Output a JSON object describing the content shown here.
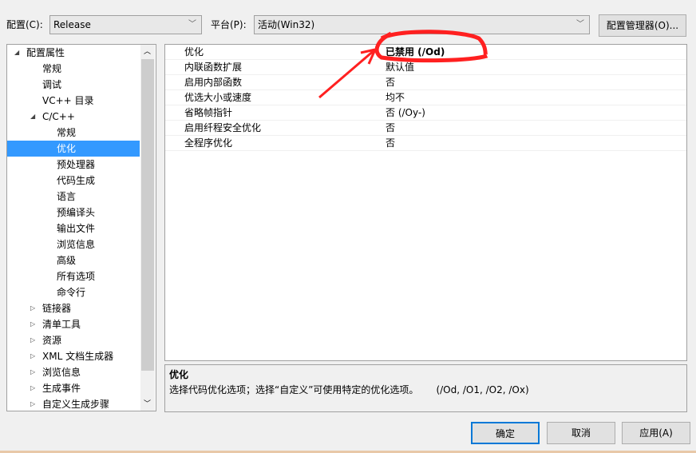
{
  "toolbar": {
    "config_label": "配置(C):",
    "config_value": "Release",
    "platform_label": "平台(P):",
    "platform_value": "活动(Win32)",
    "config_manager": "配置管理器(O)..."
  },
  "tree": [
    {
      "label": "配置属性",
      "level": 0,
      "expander": "◢"
    },
    {
      "label": "常规",
      "level": 1
    },
    {
      "label": "调试",
      "level": 1
    },
    {
      "label": "VC++ 目录",
      "level": 1
    },
    {
      "label": "C/C++",
      "level": 1,
      "expander": "◢"
    },
    {
      "label": "常规",
      "level": 2
    },
    {
      "label": "优化",
      "level": 2,
      "selected": true
    },
    {
      "label": "预处理器",
      "level": 2
    },
    {
      "label": "代码生成",
      "level": 2
    },
    {
      "label": "语言",
      "level": 2
    },
    {
      "label": "预编译头",
      "level": 2
    },
    {
      "label": "输出文件",
      "level": 2
    },
    {
      "label": "浏览信息",
      "level": 2
    },
    {
      "label": "高级",
      "level": 2
    },
    {
      "label": "所有选项",
      "level": 2
    },
    {
      "label": "命令行",
      "level": 2
    },
    {
      "label": "链接器",
      "level": 1,
      "expander": "▷"
    },
    {
      "label": "清单工具",
      "level": 1,
      "expander": "▷"
    },
    {
      "label": "资源",
      "level": 1,
      "expander": "▷"
    },
    {
      "label": "XML 文档生成器",
      "level": 1,
      "expander": "▷"
    },
    {
      "label": "浏览信息",
      "level": 1,
      "expander": "▷"
    },
    {
      "label": "生成事件",
      "level": 1,
      "expander": "▷"
    },
    {
      "label": "自定义生成步骤",
      "level": 1,
      "expander": "▷"
    }
  ],
  "properties": [
    {
      "name": "优化",
      "value": "已禁用 (/Od)",
      "bold": true
    },
    {
      "name": "内联函数扩展",
      "value": "默认值"
    },
    {
      "name": "启用内部函数",
      "value": "否"
    },
    {
      "name": "优选大小或速度",
      "value": "均不"
    },
    {
      "name": "省略帧指针",
      "value": "否 (/Oy-)"
    },
    {
      "name": "启用纤程安全优化",
      "value": "否"
    },
    {
      "name": "全程序优化",
      "value": "否"
    }
  ],
  "description": {
    "title": "优化",
    "text": "选择代码优化选项；选择“自定义”可使用特定的优化选项。",
    "switches": "(/Od, /O1, /O2, /Ox)"
  },
  "buttons": {
    "ok": "确定",
    "cancel": "取消",
    "apply": "应用(A)"
  },
  "annotation_color": "#ff2020"
}
